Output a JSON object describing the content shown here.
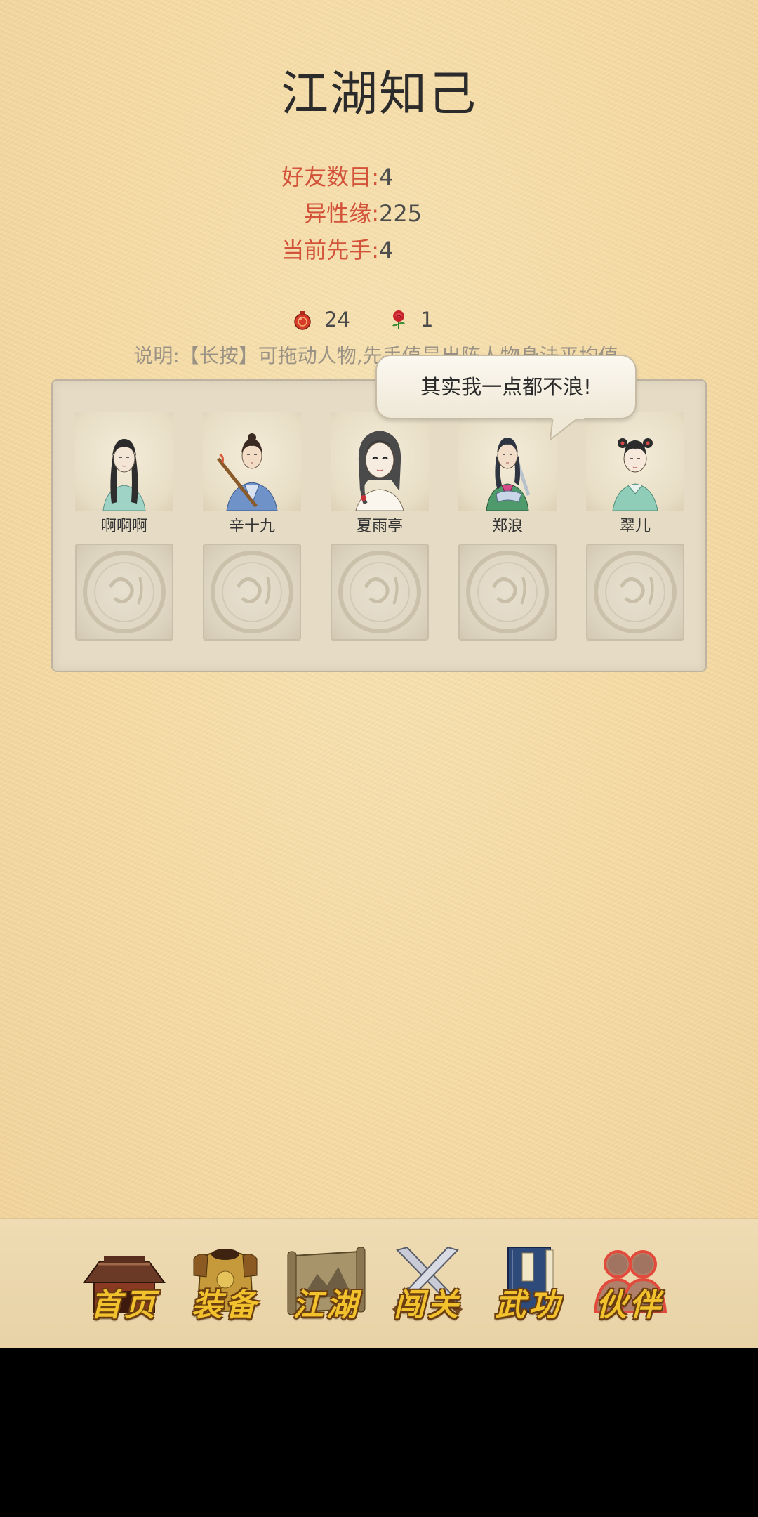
{
  "page": {
    "title": "江湖知己"
  },
  "stats": [
    {
      "label": "好友数目:",
      "value": "4"
    },
    {
      "label": "异性缘:",
      "value": "225"
    },
    {
      "label": "当前先手:",
      "value": "4"
    }
  ],
  "resources": [
    {
      "icon": "red-gourd-icon",
      "value": "24"
    },
    {
      "icon": "rose-icon",
      "value": "1"
    }
  ],
  "note": "说明:【长按】可拖动人物,先手值是出阵人物身法平均值.",
  "speech_bubble": {
    "text": "其实我一点都不浪!"
  },
  "partners": [
    {
      "name": "啊啊啊",
      "icon": "female-swordswoman-portrait"
    },
    {
      "name": "辛十九",
      "icon": "staff-fighter-portrait"
    },
    {
      "name": "夏雨亭",
      "icon": "long-haired-girl-portrait"
    },
    {
      "name": "郑浪",
      "icon": "sword-carrier-portrait"
    },
    {
      "name": "翠儿",
      "icon": "maid-girl-portrait"
    }
  ],
  "empty_slots": 5,
  "nav": [
    {
      "label": "首页",
      "icon": "temple-icon",
      "active": false
    },
    {
      "label": "装备",
      "icon": "armor-icon",
      "active": false
    },
    {
      "label": "江湖",
      "icon": "scroll-map-icon",
      "active": false
    },
    {
      "label": "闯关",
      "icon": "crossed-swords-icon",
      "active": false
    },
    {
      "label": "武功",
      "icon": "martial-book-icon",
      "active": false
    },
    {
      "label": "伙伴",
      "icon": "partners-icon",
      "active": true
    }
  ],
  "colors": {
    "stat_label": "#d2533a",
    "stat_value": "#4d4d4d",
    "nav_label": "#f2c12e",
    "active_glow": "#e24a3c"
  }
}
